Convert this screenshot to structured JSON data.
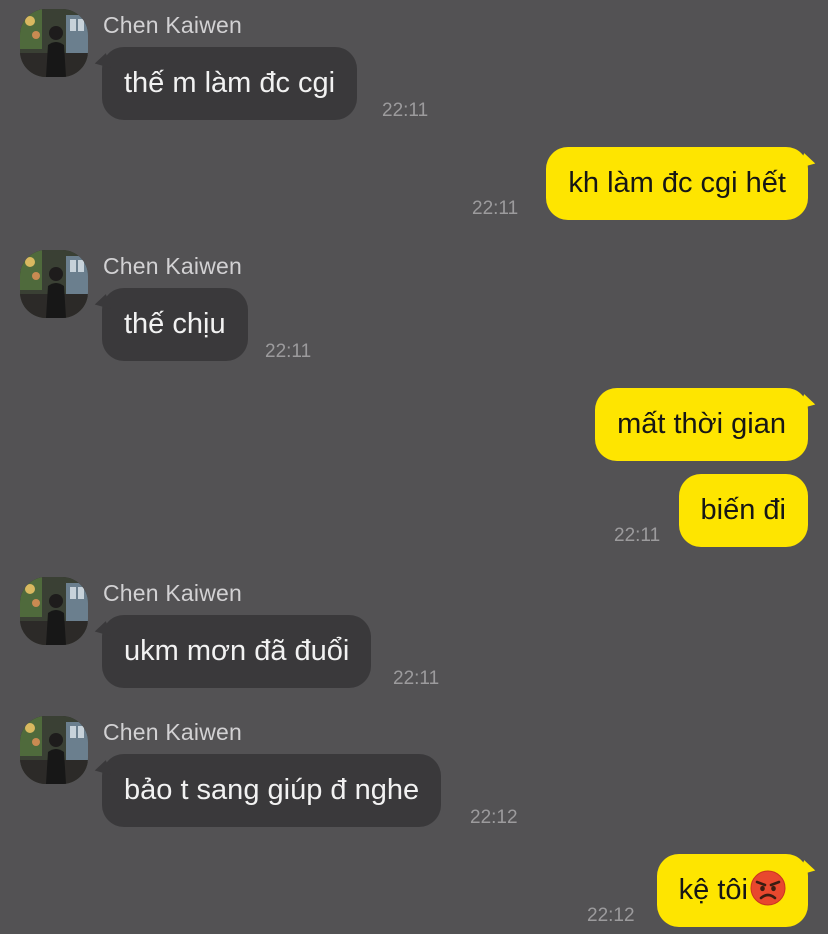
{
  "colors": {
    "background": "#535254",
    "incoming_bubble": "#3a393b",
    "outgoing_bubble": "#fee500",
    "sender_name": "#d2d1d3",
    "timestamp": "#9c9b9d"
  },
  "messages": [
    {
      "direction": "incoming",
      "sender": "Chen Kaiwen",
      "text": "thế m làm đc cgi",
      "time": "22:11"
    },
    {
      "direction": "outgoing",
      "text": "kh làm đc cgi hết",
      "time": "22:11"
    },
    {
      "direction": "incoming",
      "sender": "Chen Kaiwen",
      "text": "thế chịu",
      "time": "22:11"
    },
    {
      "direction": "outgoing",
      "text": "mất thời gian"
    },
    {
      "direction": "outgoing",
      "text": "biến đi",
      "time": "22:11"
    },
    {
      "direction": "incoming",
      "sender": "Chen Kaiwen",
      "text": "ukm mơn đã đuổi",
      "time": "22:11"
    },
    {
      "direction": "incoming",
      "sender": "Chen Kaiwen",
      "text": "bảo t sang giúp đ nghe",
      "time": "22:12"
    },
    {
      "direction": "outgoing",
      "text": "kệ tôi",
      "emoji": "angry-face-icon",
      "time": "22:12"
    }
  ]
}
